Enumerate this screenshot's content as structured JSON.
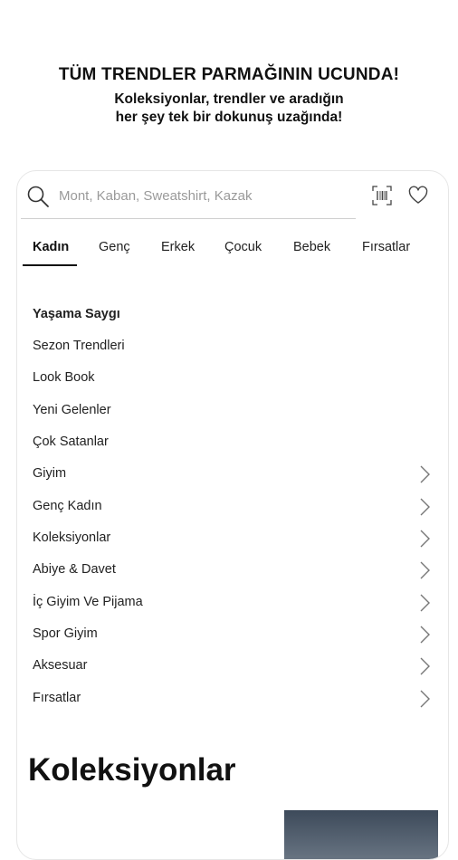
{
  "promo": {
    "title": "TÜM TRENDLER PARMAĞININ UCUNDA!",
    "subtitle_line1": "Koleksiyonlar, trendler ve aradığın",
    "subtitle_line2": "her şey tek bir dokunuş uzağında!"
  },
  "search": {
    "placeholder": "Mont, Kaban, Sweatshirt, Kazak",
    "icons": [
      "search-icon",
      "barcode-scan-icon",
      "heart-icon"
    ]
  },
  "tabs": [
    {
      "label": "Kadın",
      "active": true
    },
    {
      "label": "Genç",
      "active": false
    },
    {
      "label": "Erkek",
      "active": false
    },
    {
      "label": "Çocuk",
      "active": false
    },
    {
      "label": "Bebek",
      "active": false
    },
    {
      "label": "Fırsatlar",
      "active": false
    }
  ],
  "menu": [
    {
      "label": "Yaşama Saygı",
      "bold": true,
      "chevron": false
    },
    {
      "label": "Sezon Trendleri",
      "bold": false,
      "chevron": false
    },
    {
      "label": "Look Book",
      "bold": false,
      "chevron": false
    },
    {
      "label": "Yeni Gelenler",
      "bold": false,
      "chevron": false
    },
    {
      "label": "Çok Satanlar",
      "bold": false,
      "chevron": false
    },
    {
      "label": "Giyim",
      "bold": false,
      "chevron": true
    },
    {
      "label": "Genç Kadın",
      "bold": false,
      "chevron": true
    },
    {
      "label": "Koleksiyonlar",
      "bold": false,
      "chevron": true
    },
    {
      "label": "Abiye & Davet",
      "bold": false,
      "chevron": true
    },
    {
      "label": "İç Giyim Ve Pijama",
      "bold": false,
      "chevron": true
    },
    {
      "label": "Spor Giyim",
      "bold": false,
      "chevron": true
    },
    {
      "label": "Aksesuar",
      "bold": false,
      "chevron": true
    },
    {
      "label": "Fırsatlar",
      "bold": false,
      "chevron": true
    }
  ],
  "collections": {
    "title": "Koleksiyonlar"
  },
  "colors": {
    "text": "#111111",
    "muted": "#9a9a9a",
    "divider": "#cfcfcf"
  }
}
